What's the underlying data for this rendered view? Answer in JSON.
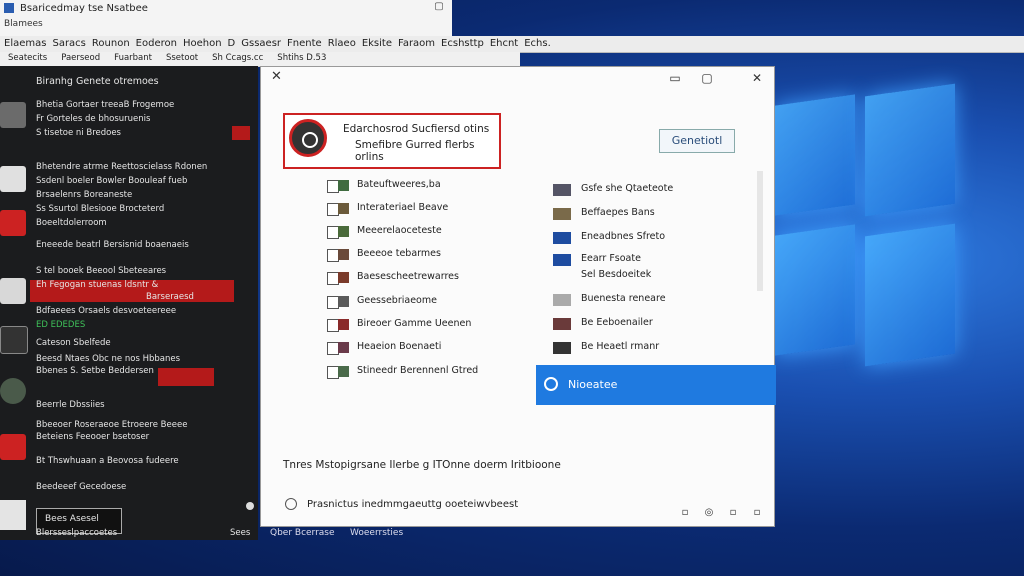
{
  "window": {
    "title": "Bsaricedmay tse Nsatbee"
  },
  "toolbar": {
    "left": "Blamees",
    "right": ""
  },
  "menu": [
    "Elaemas",
    "Saracs",
    "Rounon",
    "Eoderon",
    "Hoehon",
    "D",
    "Gssaesr",
    "Fnente",
    "Rlaeo",
    "Eksite",
    "Faraom",
    "Ecshsttp",
    "Ehcnt",
    "Echs."
  ],
  "toolbar2": [
    "Seatecits",
    "Paerseod",
    "Fuarbant",
    "Ssetoot",
    "Sh Ccags.cc",
    "Shtihs D.53"
  ],
  "sidebar": {
    "header": "Biranhg   Genete otremoes",
    "items": [
      {
        "l1": "Bhetia Gortaer treeaB Frogemoe",
        "l2": "Fr Gorteles de bhosuruenis",
        "l3": "S tisetoe ni Bredoes"
      },
      {
        "l1": "Bhetendre atrme Reettoscielass Rdonen",
        "l2": "Ssdenl boeler Bowler Boouleaf fueb",
        "l3": "Brsaelenrs Boreaneste",
        "l4": "Ss Ssurtol Blesiooe Brocteterd",
        "l5": "Boeeltdolerroom"
      },
      {
        "l1": "Eneeede beatrl Bersisnid boaenaeis",
        "l2": "S tel booek Beeool Sbeteeares"
      },
      {
        "l1": "Eh Fegogan stuenas ldsntr &",
        "l2": "Bdfaeees Orsaels desvoeteereee",
        "red": "Barseraesd"
      },
      {
        "green": "ED EDEDES",
        "l1": "Cateson Sbelfede"
      },
      {
        "l1": "Beesd Ntaes Obc ne nos Hbbanes",
        "l2": "Bbenes S. Setbe Beddersen"
      },
      {
        "l1": "Beerrle Dbssiies"
      },
      {
        "l1": "Bbeeoer Roseraeoe Etroeere Beeee",
        "l2": "Beteiens Feeooer bsetoser",
        "l3": "Bt Thswhuaan a Beovosa fudeere"
      },
      {
        "l1": "Beedeeef Gecedoese"
      },
      {
        "box": "Bees Asesel",
        "l2": "Blersseslpaccoetes",
        "right": "Sees"
      }
    ]
  },
  "dialog": {
    "note_line1": "Edarchosrod Sucfiersd otins",
    "note_line2": "Smefibre Gurred flerbs orlins",
    "button": "Genetiotl",
    "left_items": [
      "Bateuftweeres,ba",
      "Interateriael Beave",
      "Meeerelaoceteste",
      "Beeeoe tebarmes",
      "Baesescheetrewarres",
      "Geessebriaeome",
      "Bireoer Gamme Ueenen",
      "Heaeion Boenaeti",
      "Stineedr Berennenl Gtred"
    ],
    "right_items": [
      "Gsfe she Qtaeteote",
      "Beffaepes Bans",
      "Eneadbnes Sfreto",
      "Eearr Fsoate",
      "Sel Besdoeitek",
      "Buenesta reneare",
      "Be Eeboenailer",
      "Be Heaetl rmanr"
    ],
    "selected": "Nioeatee",
    "footer1": "Tnres Mstopigrsane  Ilerbe  g ITOnne doerm  Iritbioone",
    "footer2": "Prasnictus inedmmgaeuttg ooeteiwvbeest"
  },
  "taskbar": [
    "Qber Bcerrase",
    "Woeerrsties"
  ]
}
